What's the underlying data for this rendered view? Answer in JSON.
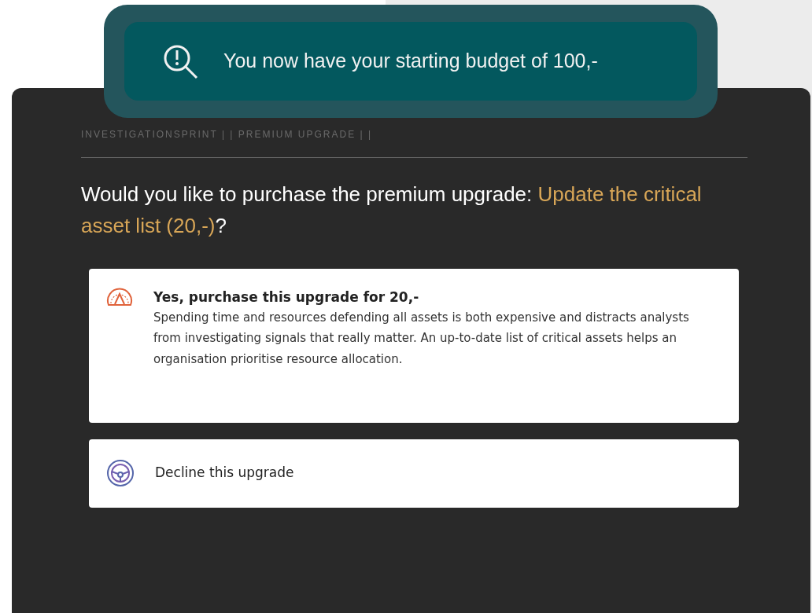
{
  "toast": {
    "message": "You now have your starting budget of 100,-"
  },
  "breadcrumb": "INVESTIGATIONSPRINT | | PREMIUM UPGRADE | |",
  "question": {
    "prefix": "Would you like to purchase the premium upgrade: ",
    "highlight": "Update the critical asset list (20,-)",
    "suffix": "?"
  },
  "options": [
    {
      "kind": "accept",
      "title": "Yes, purchase this upgrade for 20,-",
      "description": "Spending time and resources defending all assets is both expensive and distracts analysts from investigating signals that really matter. An up-to-date list of critical assets helps an organisation prioritise resource allocation."
    },
    {
      "kind": "decline",
      "title": "Decline this upgrade"
    }
  ]
}
